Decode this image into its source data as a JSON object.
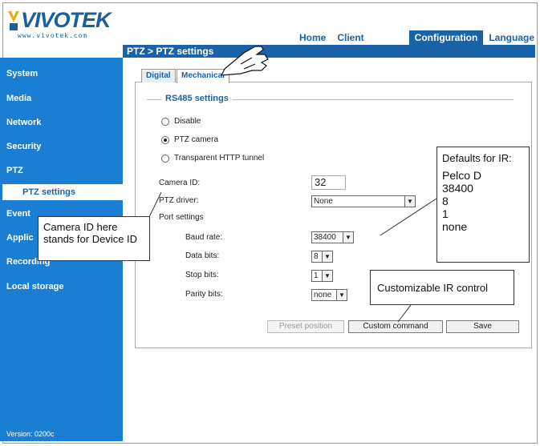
{
  "header": {
    "logo_text": "VIVOTEK",
    "logo_url": "www.vivotek.com",
    "nav": [
      "Home",
      "Client settings",
      "Configuration",
      "Language"
    ],
    "active_nav": "Configuration"
  },
  "sidebar": {
    "items": [
      "System",
      "Media",
      "Network",
      "Security",
      "PTZ",
      "Event",
      "Applic",
      "Recording",
      "Local storage"
    ],
    "sub_item": "PTZ settings",
    "version": "Version: 0200c"
  },
  "page": {
    "title": "PTZ > PTZ settings",
    "tabs": [
      "Digital",
      "Mechanical"
    ],
    "active_tab": "Mechanical",
    "legend": "RS485 settings",
    "options": [
      "Disable",
      "PTZ camera",
      "Transparent HTTP tunnel"
    ],
    "selected_option": "PTZ camera",
    "camera_id_label": "Camera ID:",
    "camera_id_value": "32",
    "ptz_driver_label": "PTZ driver:",
    "ptz_driver_value": "None",
    "port_settings_label": "Port settings",
    "baud_rate_label": "Baud rate:",
    "baud_rate_value": "38400",
    "data_bits_label": "Data bits:",
    "data_bits_value": "8",
    "stop_bits_label": "Stop bits:",
    "stop_bits_value": "1",
    "parity_bits_label": "Parity bits:",
    "parity_bits_value": "none",
    "buttons": {
      "preset": "Preset position",
      "custom": "Custom command",
      "save": "Save"
    }
  },
  "annotations": {
    "defaults_title": "Defaults for IR:",
    "defaults_values": [
      "Pelco D",
      "38400",
      "8",
      "1",
      "none"
    ],
    "camera_id_note_line1": "Camera ID here",
    "camera_id_note_line2": "stands for Device ID",
    "custom_ir_note": "Customizable IR control"
  },
  "colors": {
    "brand_blue": "#1a63a8",
    "sidebar_blue": "#1a7fd3"
  }
}
